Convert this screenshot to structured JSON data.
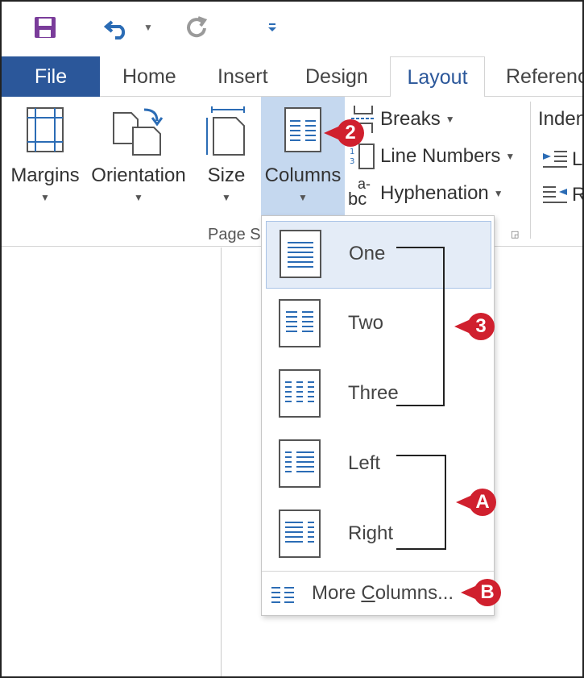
{
  "qat": {
    "save_icon": "save-icon",
    "undo_icon": "undo-icon",
    "redo_icon": "redo-icon",
    "customize_icon": "customize-qat-icon"
  },
  "tabs": [
    "File",
    "Home",
    "Insert",
    "Design",
    "Layout",
    "Referenc"
  ],
  "ribbon": {
    "margins": "Margins",
    "orientation": "Orientation",
    "size": "Size",
    "columns": "Columns",
    "breaks": "Breaks",
    "line_numbers": "Line Numbers",
    "hyphenation": "Hyphenation",
    "hyphen_glyph_top": "a-",
    "hyphen_glyph_bottom": "bc",
    "group_label": "Page S",
    "indent_label": "Inden",
    "indent_left_prefix": "L",
    "indent_right_prefix": "R"
  },
  "dropdown": {
    "items": [
      {
        "label": "One",
        "icon": "one-column-icon"
      },
      {
        "label": "Two",
        "icon": "two-columns-icon"
      },
      {
        "label": "Three",
        "icon": "three-columns-icon"
      },
      {
        "label": "Left",
        "icon": "left-column-icon"
      },
      {
        "label": "Right",
        "icon": "right-column-icon"
      }
    ],
    "more_pre": "More ",
    "more_u": "C",
    "more_post": "olumns..."
  },
  "callouts": {
    "step2": "2",
    "step3": "3",
    "a": "A",
    "b": "B"
  },
  "colors": {
    "file_tab": "#2b579a",
    "selected_button": "#c5d8ef",
    "callout": "#d0202e",
    "icon_blue": "#2b6cb5"
  }
}
